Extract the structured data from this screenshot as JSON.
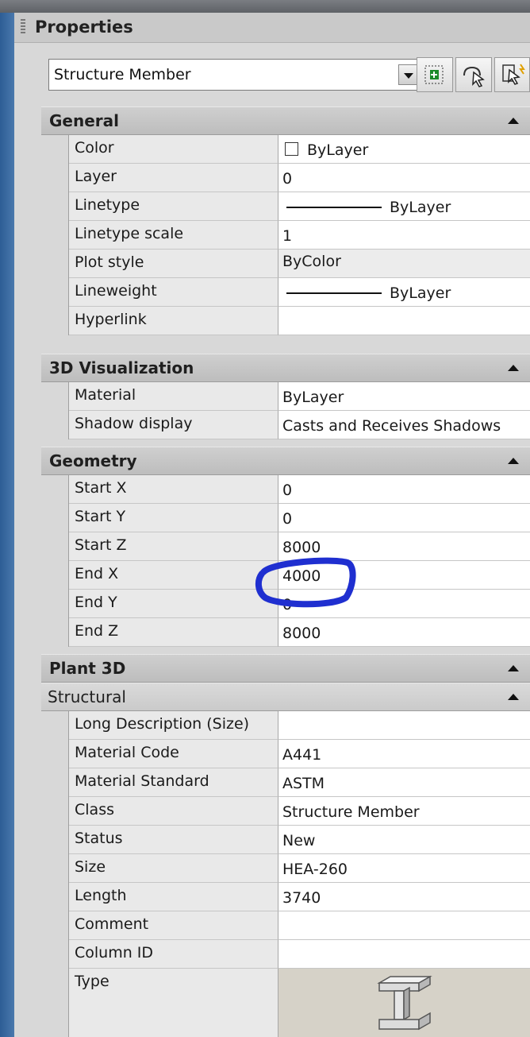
{
  "panel": {
    "title": "Properties"
  },
  "selector": {
    "value": "Structure Member"
  },
  "toolbar": {
    "icons": [
      "quick-select-icon",
      "select-objects-icon",
      "pickadd-icon"
    ]
  },
  "sections": {
    "general": {
      "label": "General",
      "rows": [
        {
          "name": "Color",
          "value": "ByLayer"
        },
        {
          "name": "Layer",
          "value": "0"
        },
        {
          "name": "Linetype",
          "value": "ByLayer"
        },
        {
          "name": "Linetype scale",
          "value": "1"
        },
        {
          "name": "Plot style",
          "value": "ByColor"
        },
        {
          "name": "Lineweight",
          "value": "ByLayer"
        },
        {
          "name": "Hyperlink",
          "value": ""
        }
      ]
    },
    "viz": {
      "label": "3D Visualization",
      "rows": [
        {
          "name": "Material",
          "value": "ByLayer"
        },
        {
          "name": "Shadow display",
          "value": "Casts and Receives Shadows"
        }
      ]
    },
    "geometry": {
      "label": "Geometry",
      "rows": [
        {
          "name": "Start X",
          "value": "0"
        },
        {
          "name": "Start Y",
          "value": "0"
        },
        {
          "name": "Start Z",
          "value": "8000"
        },
        {
          "name": "End X",
          "value": "4000"
        },
        {
          "name": "End Y",
          "value": "0"
        },
        {
          "name": "End Z",
          "value": "8000"
        }
      ]
    },
    "plant": {
      "label": "Plant 3D"
    },
    "structural": {
      "label": "Structural",
      "rows": [
        {
          "name": "Long Description (Size)",
          "value": ""
        },
        {
          "name": "Material Code",
          "value": "A441"
        },
        {
          "name": "Material Standard",
          "value": "ASTM"
        },
        {
          "name": "Class",
          "value": "Structure Member"
        },
        {
          "name": "Status",
          "value": "New"
        },
        {
          "name": "Size",
          "value": "HEA-260"
        },
        {
          "name": "Length",
          "value": "3740"
        },
        {
          "name": "Comment",
          "value": ""
        },
        {
          "name": "Column ID",
          "value": ""
        },
        {
          "name": "Type",
          "value": ""
        }
      ]
    }
  },
  "colors": {
    "annotation_ink": "#1f2fd0",
    "section_bg": "#c4c4c4",
    "name_bg": "#e9e9e9",
    "value_bg": "#ffffff"
  }
}
